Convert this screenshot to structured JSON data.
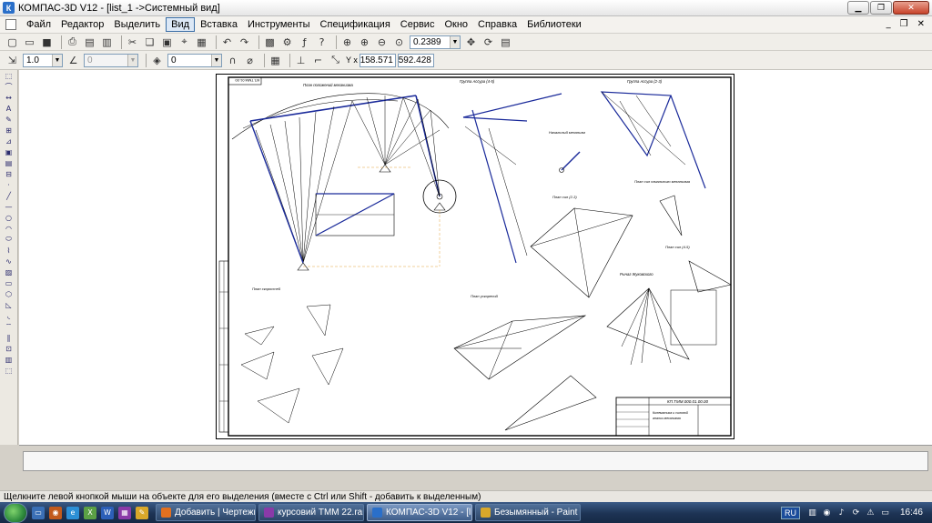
{
  "window": {
    "title": "КОМПАС-3D V12 - [list_1 ->Системный вид]",
    "app_icon": "К"
  },
  "menu": {
    "items": [
      "Файл",
      "Редактор",
      "Выделить",
      "Вид",
      "Вставка",
      "Инструменты",
      "Спецификация",
      "Сервис",
      "Окно",
      "Справка",
      "Библиотеки"
    ],
    "active_index": 3
  },
  "toolbar": {
    "zoom_value": "0.2389"
  },
  "toolbar2": {
    "step_value": "1.0",
    "angle_value": "0",
    "layer_value": "0",
    "coord_x": "158.571",
    "coord_y": "592.428",
    "coord_label": "Y x"
  },
  "drawing": {
    "labels": {
      "mech_plan": "План положений механизма",
      "group1": "Группа Ассура (4-5)",
      "group2": "Группа Ассура (2-3)",
      "initial_mech": "Начальный механизм",
      "forces_23": "План сил (2-3)",
      "forces_initial": "План сил начального механизма",
      "forces_45": "План сил (4-5)",
      "velocities": "План скоростей",
      "zhukovsky": "Рычаг Жуковского",
      "accelerations": "План ускорений",
      "stamp_code": "КП.ТММ.000.01.00.00",
      "stamp_title1": "Кинематика и силовой",
      "stamp_title2": "анализ механизма",
      "corner_code": "КП.ТММ.01.00"
    }
  },
  "status": {
    "hint": "Щелкните левой кнопкой мыши на объекте для его выделения (вместе с Ctrl или Shift - добавить к выделенным)"
  },
  "taskbar": {
    "tasks": [
      {
        "label": "Добавить | Чертежи ...",
        "color": "#e2701f"
      },
      {
        "label": "курсовий ТММ 22.rar ...",
        "color": "#8a3aa8"
      },
      {
        "label": "КОМПАС-3D V12 - [lis...",
        "color": "#2a6fc9"
      },
      {
        "label": "Безымянный - Paint",
        "color": "#d9a82a"
      }
    ],
    "active_index": 2,
    "lang": "RU",
    "clock": "16:46"
  }
}
